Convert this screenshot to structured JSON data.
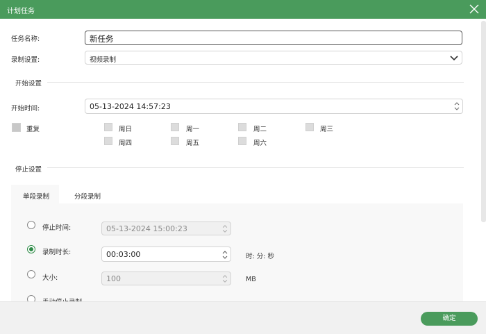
{
  "window": {
    "title": "计划任务"
  },
  "form": {
    "task_name_label": "任务名称:",
    "task_name_value": "新任务",
    "record_setting_label": "录制设置:",
    "record_setting_value": "视频录制"
  },
  "start": {
    "section_title": "开始设置",
    "time_label": "开始时间:",
    "time_value": "05-13-2024 14:57:23",
    "repeat_label": "重复",
    "days": [
      "周日",
      "周一",
      "周二",
      "周三",
      "周四",
      "周五",
      "周六"
    ]
  },
  "stop": {
    "section_title": "停止设置",
    "tabs": [
      "单段录制",
      "分段录制"
    ],
    "active_tab": "单段录制",
    "stop_time_label": "停止时间:",
    "stop_time_value": "05-13-2024 15:00:23",
    "duration_label": "录制时长:",
    "duration_value": "00:03:00",
    "duration_unit": "时: 分: 秒",
    "size_label": "大小:",
    "size_value": "100",
    "size_unit": "MB",
    "manual_label": "手动停止录制",
    "selected_option": "录制时长"
  },
  "footer": {
    "ok_label": "确定"
  },
  "colors": {
    "accent": "#4a9b5c",
    "radio_selected": "#2e8b47"
  }
}
